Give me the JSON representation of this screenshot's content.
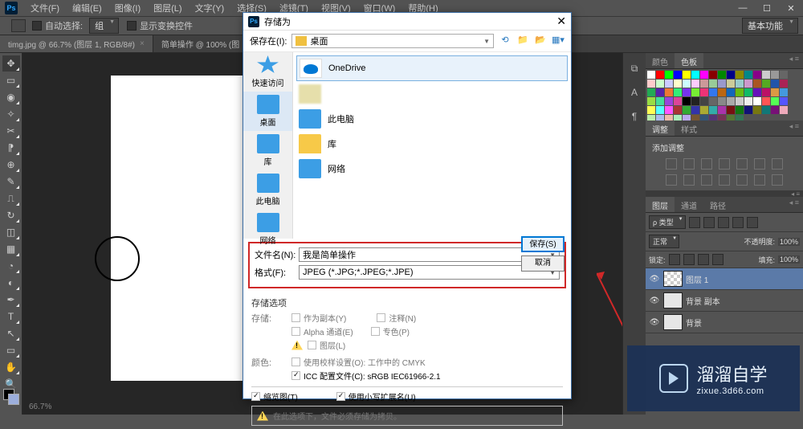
{
  "app": {
    "name": "Ps"
  },
  "menu": {
    "file": "文件(F)",
    "edit": "编辑(E)",
    "image": "图像(I)",
    "layer": "图层(L)",
    "type": "文字(Y)",
    "select": "选择(S)",
    "filter": "滤镜(T)",
    "view": "视图(V)",
    "window": "窗口(W)",
    "help": "帮助(H)"
  },
  "options": {
    "auto_select": "自动选择:",
    "group": "组",
    "transform": "显示变换控件",
    "mode": "基本功能"
  },
  "tabs": {
    "tab1": "timg.jpg @ 66.7% (图层 1, RGB/8#)",
    "tab2": "简单操作 @ 100% (图"
  },
  "status": {
    "zoom": "66.7%"
  },
  "dialog": {
    "title": "存储为",
    "save_in_label": "保存在(I):",
    "save_in_value": "桌面",
    "sidebar": {
      "quick": "快速访问",
      "desktop": "桌面",
      "library": "库",
      "pc": "此电脑",
      "network": "网络"
    },
    "files": {
      "onedrive": "OneDrive",
      "pc": "此电脑",
      "library": "库",
      "network": "网络"
    },
    "file_name_label": "文件名(N):",
    "file_name_value": "我是简单操作",
    "format_label": "格式(F):",
    "format_value": "JPEG (*.JPG;*.JPEG;*.JPE)",
    "btn_save": "保存(S)",
    "btn_cancel": "取消",
    "save_options_label": "存储选项",
    "save_field_label": "存储:",
    "as_copy": "作为副本(Y)",
    "notes": "注释(N)",
    "alpha": "Alpha 通道(E)",
    "spot": "专色(P)",
    "layers": "图层(L)",
    "color_label": "颜色:",
    "proof": "使用校样设置(O): 工作中的 CMYK",
    "icc": "ICC 配置文件(C): sRGB IEC61966-2.1",
    "thumbnail": "缩览图(T)",
    "lowercase": "使用小写扩展名(U)",
    "notice": "在此选项下，文件必须存储为拷贝。"
  },
  "panels": {
    "color_tab": "颜色",
    "swatches_tab": "色板",
    "adjust_tab": "调整",
    "styles_tab": "样式",
    "add_adjust": "添加调整",
    "layers_tab": "图层",
    "channels_tab": "通道",
    "paths_tab": "路径",
    "kind": "ρ 类型",
    "normal": "正常",
    "opacity_label": "不透明度:",
    "opacity_val": "100%",
    "lock_label": "锁定:",
    "fill_label": "填充:",
    "fill_val": "100%",
    "layer1_name": "图层 1",
    "layer2_name": "背景 副本",
    "layer3_name": "背景"
  },
  "watermark": {
    "big": "溜溜自学",
    "small": "zixue.3d66.com"
  },
  "swatch_colors": [
    "#fff",
    "#f00",
    "#0f0",
    "#00f",
    "#ff0",
    "#0ff",
    "#f0f",
    "#800",
    "#080",
    "#008",
    "#880",
    "#088",
    "#808",
    "#ccc",
    "#999",
    "#666",
    "#fcc",
    "#cfc",
    "#ccf",
    "#ffc",
    "#cff",
    "#fcf",
    "#c99",
    "#9c9",
    "#99c",
    "#cc9",
    "#9cc",
    "#c9c",
    "#a52",
    "#5a2",
    "#25a",
    "#a25",
    "#2a5",
    "#52a",
    "#e73",
    "#3e7",
    "#73e",
    "#7e3",
    "#e37",
    "#37e",
    "#b61",
    "#16b",
    "#6b1",
    "#1b6",
    "#61b",
    "#b16",
    "#d94",
    "#49d",
    "#9d4",
    "#4d9",
    "#94d",
    "#d49",
    "#000",
    "#222",
    "#444",
    "#666",
    "#888",
    "#aaa",
    "#ccc",
    "#eee",
    "#fff",
    "#f55",
    "#5f5",
    "#55f",
    "#ff5",
    "#5ff",
    "#f5f",
    "#a33",
    "#3a3",
    "#33a",
    "#aa3",
    "#3aa",
    "#a3a",
    "#711",
    "#171",
    "#117",
    "#771",
    "#177",
    "#717",
    "#eab",
    "#bea",
    "#abe",
    "#eba",
    "#aeb",
    "#bae",
    "#753",
    "#357",
    "#537",
    "#735",
    "#573",
    "#375"
  ]
}
